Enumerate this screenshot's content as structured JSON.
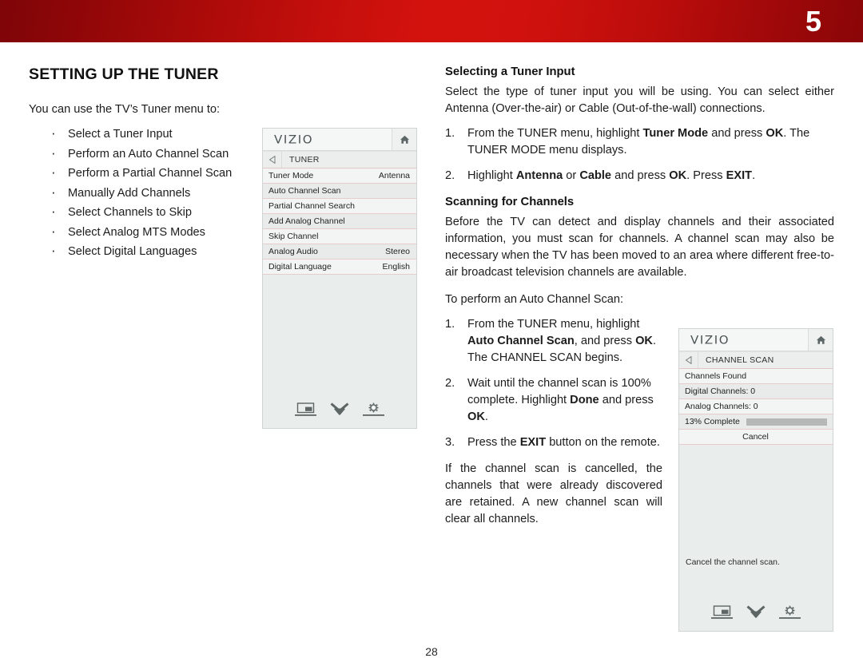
{
  "header": {
    "chapter_number": "5"
  },
  "page": {
    "number": "28"
  },
  "left": {
    "title": "SETTING UP THE TUNER",
    "intro": "You can use the TV’s Tuner menu to:",
    "bullets": [
      "Select a Tuner Input",
      "Perform an Auto Channel Scan",
      "Perform a Partial Channel Scan",
      "Manually Add Channels",
      "Select Channels to Skip",
      "Select Analog MTS Modes",
      "Select Digital Languages"
    ]
  },
  "right": {
    "tuner_input": {
      "heading": "Selecting a Tuner Input",
      "paragraph": "Select the type of tuner input you will be using. You can select either Antenna (Over-the-air) or Cable (Out-of-the-wall) connections.",
      "step1_a": "From the TUNER menu, highlight ",
      "step1_b": "Tuner Mode",
      "step1_c": " and press ",
      "step1_d": "OK",
      "step1_e": ". The TUNER MODE menu displays.",
      "step2_a": "Highlight ",
      "step2_b": "Antenna",
      "step2_c": " or ",
      "step2_d": "Cable",
      "step2_e": " and press ",
      "step2_f": "OK",
      "step2_g": ". Press ",
      "step2_h": "EXIT",
      "step2_i": "."
    },
    "scanning": {
      "heading": "Scanning for Channels",
      "paragraph": "Before the TV can detect and display channels and their associated information, you must scan for channels. A channel scan may also be necessary when the TV has been moved to an area where different free-to-air broadcast television channels are available.",
      "lead_in": "To perform an Auto Channel Scan:",
      "step1_a": "From the TUNER menu, highlight ",
      "step1_b": "Auto Channel Scan",
      "step1_c": ", and press ",
      "step1_d": "OK",
      "step1_e": ". The CHANNEL SCAN begins.",
      "step2_a": "Wait until the channel scan is 100% complete. Highlight ",
      "step2_b": "Done",
      "step2_c": " and press ",
      "step2_d": "OK",
      "step2_e": ".",
      "step3_a": "Press the ",
      "step3_b": "EXIT",
      "step3_c": " button on the remote.",
      "closing": "If the channel scan is cancelled, the channels that were already discovered are retained. A new channel scan will clear all channels."
    }
  },
  "tuner_menu": {
    "brand": "VIZIO",
    "breadcrumb": "TUNER",
    "home_icon": "home-icon",
    "back_icon": "back-arrow-icon",
    "rows": [
      {
        "label": "Tuner Mode",
        "value": "Antenna"
      },
      {
        "label": "Auto Channel Scan",
        "value": ""
      },
      {
        "label": "Partial Channel Search",
        "value": ""
      },
      {
        "label": "Add Analog Channel",
        "value": ""
      },
      {
        "label": "Skip Channel",
        "value": ""
      },
      {
        "label": "Analog Audio",
        "value": "Stereo"
      },
      {
        "label": "Digital Language",
        "value": "English"
      }
    ],
    "footer_icons": [
      "picture-in-picture-icon",
      "double-chevron-down-icon",
      "gear-icon"
    ]
  },
  "channel_scan_menu": {
    "brand": "VIZIO",
    "breadcrumb": "CHANNEL SCAN",
    "home_icon": "home-icon",
    "back_icon": "back-arrow-icon",
    "rows": [
      {
        "label": "Channels Found",
        "value": ""
      },
      {
        "label": "Digital Channels: 0",
        "value": ""
      },
      {
        "label": "Analog Channels: 0",
        "value": ""
      }
    ],
    "progress": {
      "label": "13% Complete",
      "percent": 13,
      "fill_color": "#4a4a4a",
      "track_color": "#b5b8b7"
    },
    "cancel_label": "Cancel",
    "hint": "Cancel the channel scan.",
    "footer_icons": [
      "picture-in-picture-icon",
      "double-chevron-down-icon",
      "gear-icon"
    ]
  }
}
